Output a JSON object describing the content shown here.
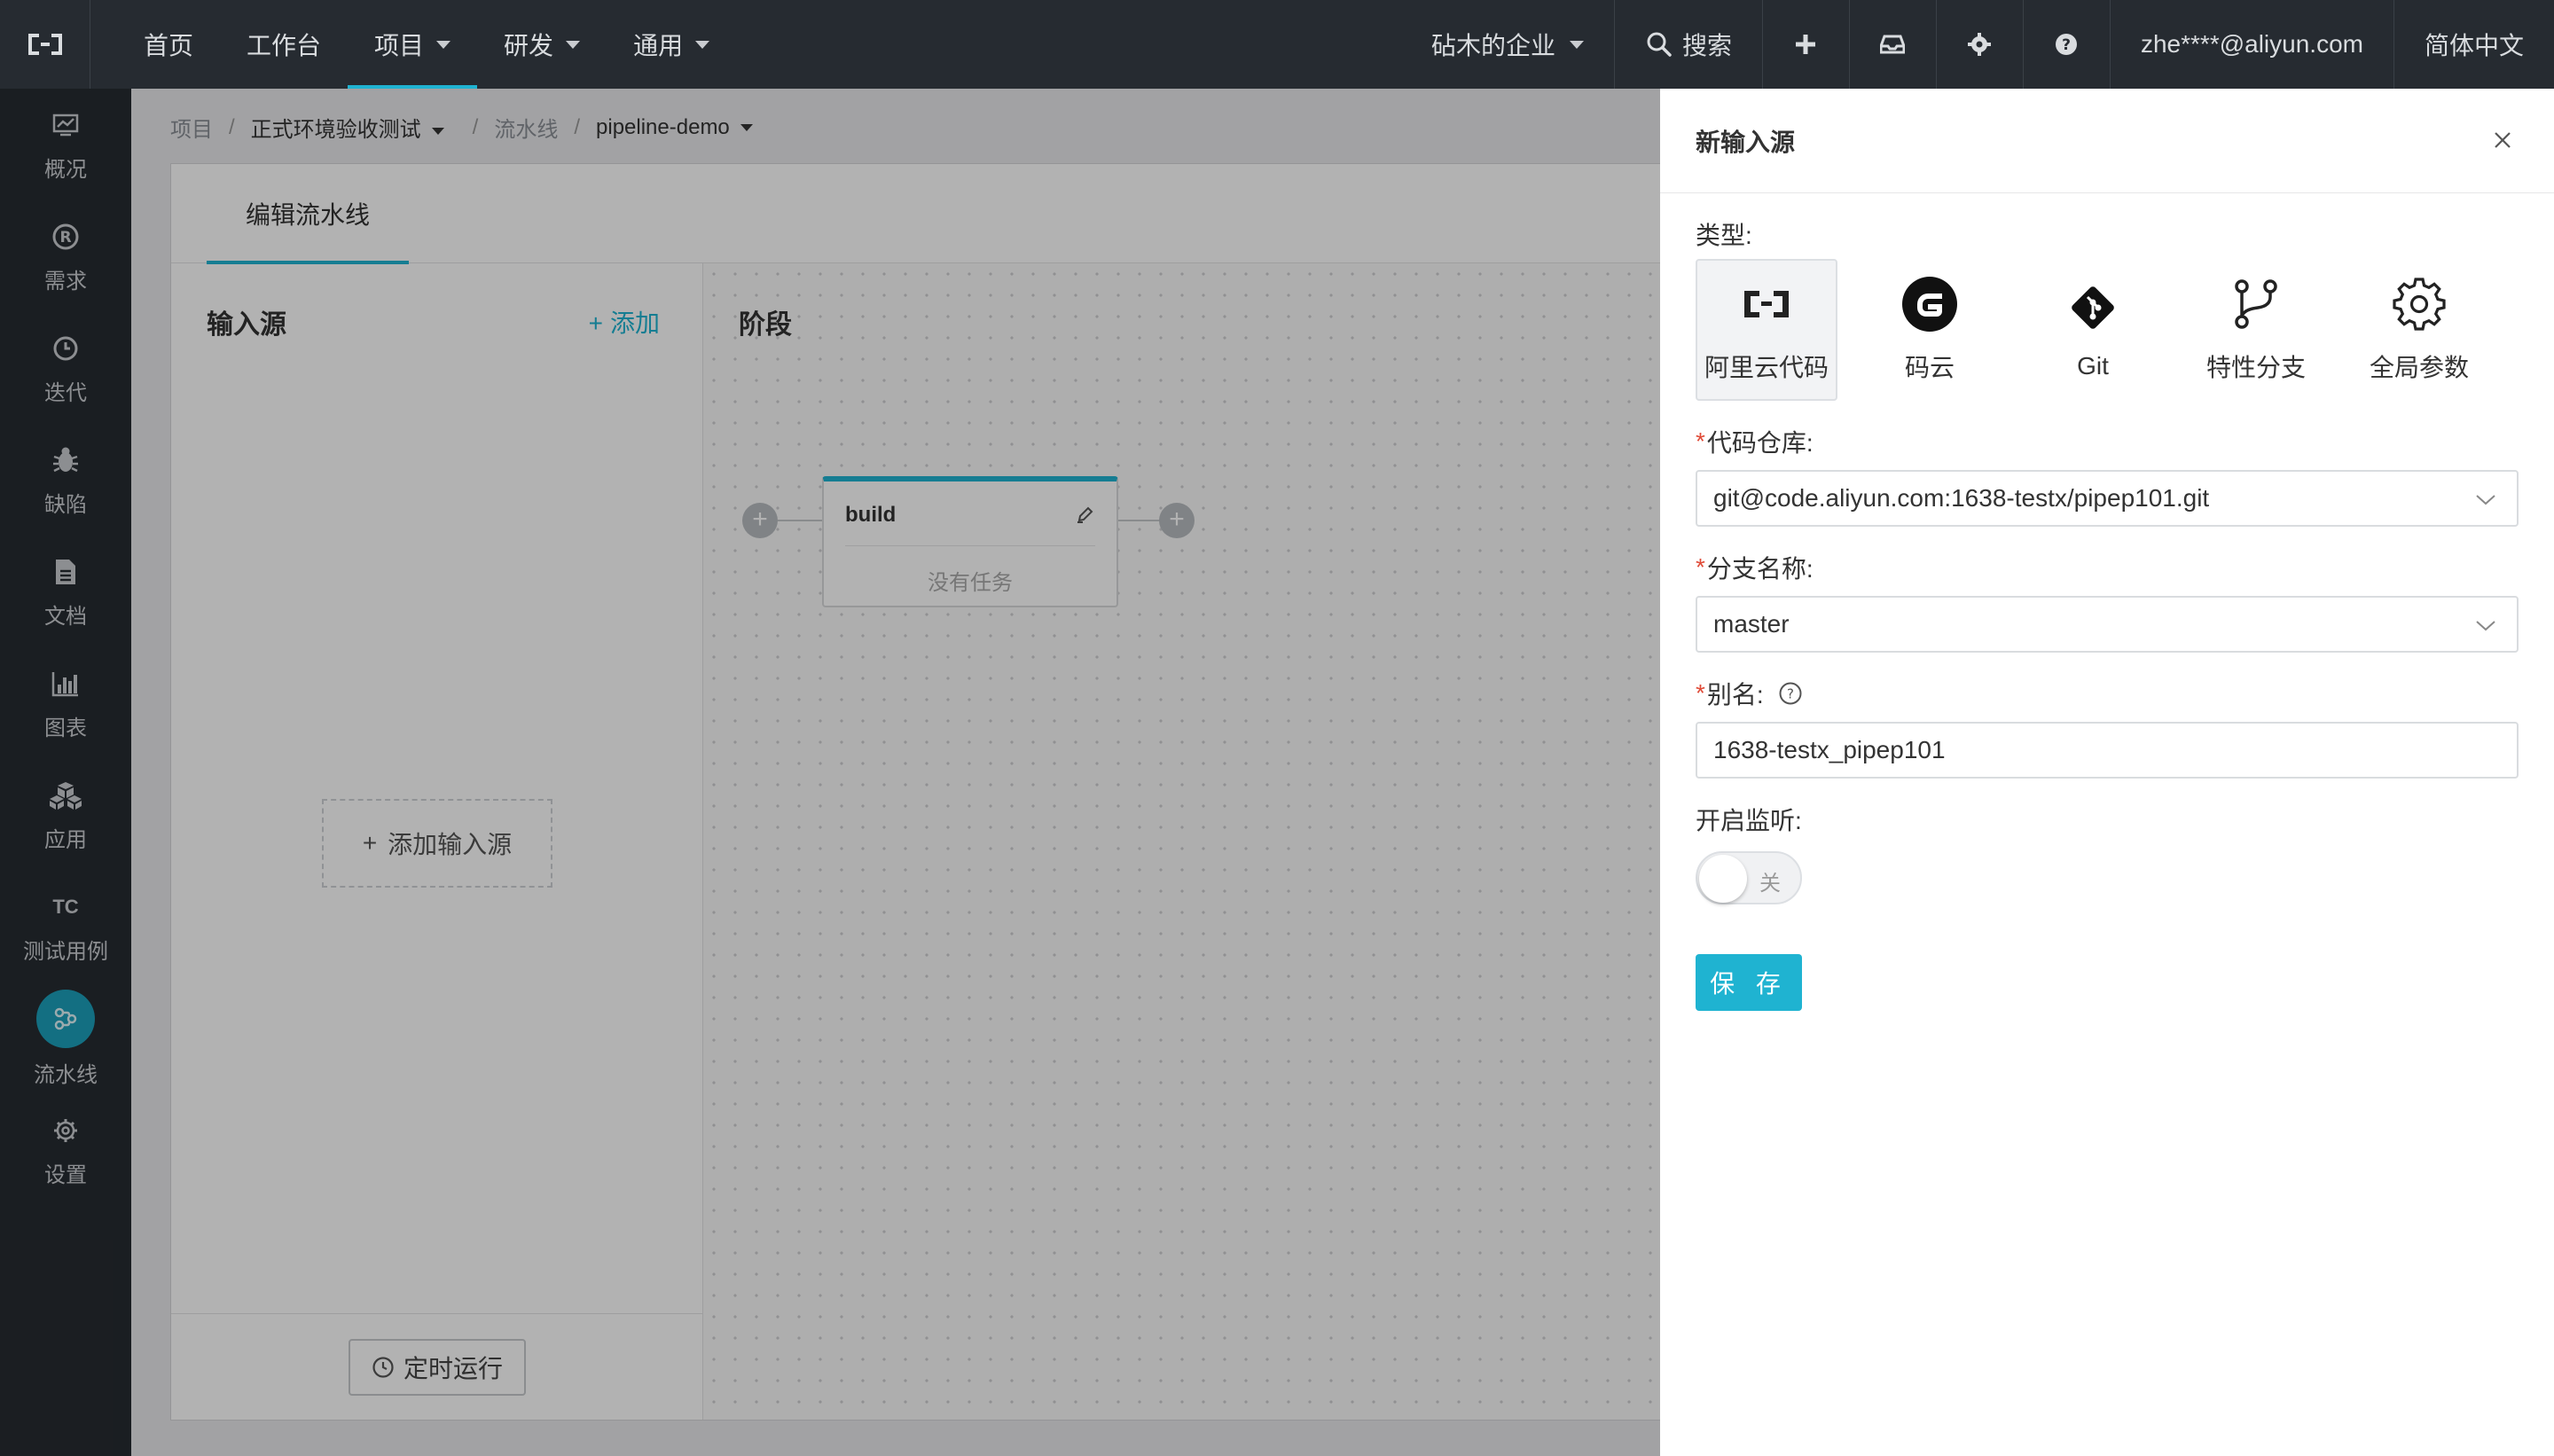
{
  "topnav": {
    "items": [
      {
        "label": "首页"
      },
      {
        "label": "工作台"
      },
      {
        "label": "项目"
      },
      {
        "label": "研发"
      },
      {
        "label": "通用"
      }
    ],
    "org": "砧木的企业",
    "search": "搜索",
    "user": "zhe****@aliyun.com",
    "language": "简体中文"
  },
  "sidebar": {
    "items": [
      {
        "label": "概况"
      },
      {
        "label": "需求"
      },
      {
        "label": "迭代"
      },
      {
        "label": "缺陷"
      },
      {
        "label": "文档"
      },
      {
        "label": "图表"
      },
      {
        "label": "应用"
      },
      {
        "label": "测试用例",
        "badge": "TC"
      },
      {
        "label": "流水线"
      },
      {
        "label": "设置"
      }
    ]
  },
  "breadcrumb": {
    "project_root": "项目",
    "project": "正式环境验收测试",
    "section": "流水线",
    "pipeline": "pipeline-demo",
    "sep": "/"
  },
  "editor": {
    "tab": "编辑流水线",
    "source_title": "输入源",
    "add": "添加",
    "add_source": "添加输入源",
    "stage_title": "阶段",
    "stage_name": "build",
    "no_tasks": "没有任务",
    "schedule": "定时运行"
  },
  "drawer": {
    "title": "新输入源",
    "type_label": "类型:",
    "types": [
      {
        "label": "阿里云代码"
      },
      {
        "label": "码云"
      },
      {
        "label": "Git"
      },
      {
        "label": "特性分支"
      },
      {
        "label": "全局参数"
      }
    ],
    "repo_label": "代码仓库:",
    "repo_value": "git@code.aliyun.com:1638-testx/pipep101.git",
    "branch_label": "分支名称:",
    "branch_value": "master",
    "alias_label": "别名:",
    "alias_value": "1638-testx_pipep101",
    "listen_label": "开启监听:",
    "listen_state": "关",
    "save": "保 存"
  },
  "colors": {
    "accent": "#1fb3d1",
    "nav_bg": "#262b31",
    "required": "#e04b38"
  }
}
